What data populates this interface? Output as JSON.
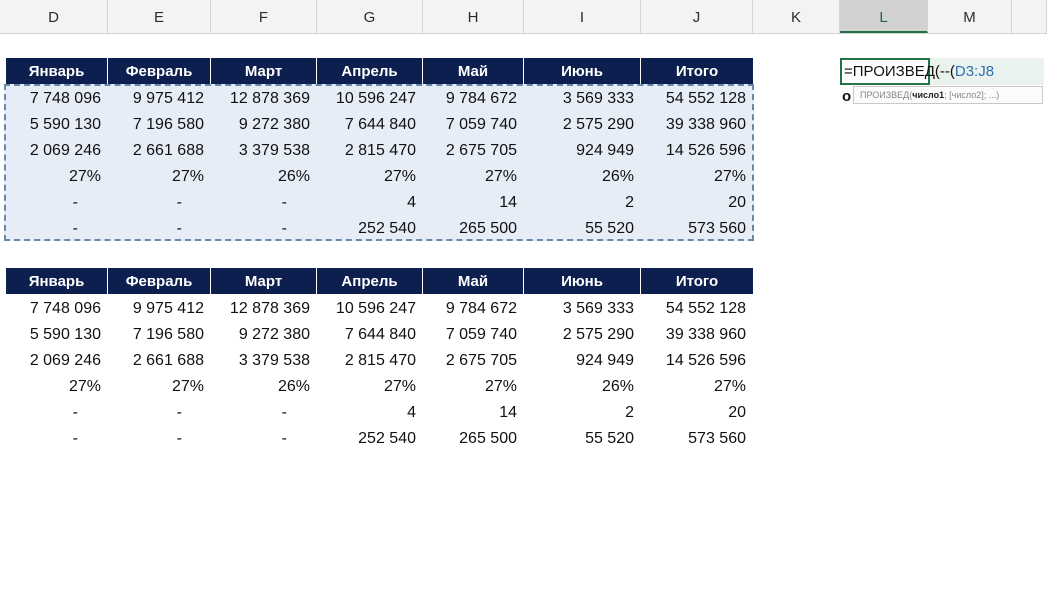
{
  "columns": [
    "D",
    "E",
    "F",
    "G",
    "H",
    "I",
    "J",
    "K",
    "L",
    "M"
  ],
  "active_column": "L",
  "table1": {
    "headers": [
      "Январь",
      "Февраль",
      "Март",
      "Апрель",
      "Май",
      "Июнь",
      "Итого"
    ],
    "rows": [
      [
        "7 748 096",
        "9 975 412",
        "12 878 369",
        "10 596 247",
        "9 784 672",
        "3 569 333",
        "54 552 128"
      ],
      [
        "5 590 130",
        "7 196 580",
        "9 272 380",
        "7 644 840",
        "7 059 740",
        "2 575 290",
        "39 338 960"
      ],
      [
        "2 069 246",
        "2 661 688",
        "3 379 538",
        "2 815 470",
        "2 675 705",
        "924 949",
        "14 526 596"
      ],
      [
        "27%",
        "27%",
        "26%",
        "27%",
        "27%",
        "26%",
        "27%"
      ],
      [
        "-",
        "-",
        "-",
        "4",
        "14",
        "2",
        "20"
      ],
      [
        "-",
        "-",
        "-",
        "252 540",
        "265 500",
        "55 520",
        "573 560"
      ]
    ]
  },
  "table2": {
    "headers": [
      "Январь",
      "Февраль",
      "Март",
      "Апрель",
      "Май",
      "Июнь",
      "Итого"
    ],
    "rows": [
      [
        "7 748 096",
        "9 975 412",
        "12 878 369",
        "10 596 247",
        "9 784 672",
        "3 569 333",
        "54 552 128"
      ],
      [
        "5 590 130",
        "7 196 580",
        "9 272 380",
        "7 644 840",
        "7 059 740",
        "2 575 290",
        "39 338 960"
      ],
      [
        "2 069 246",
        "2 661 688",
        "3 379 538",
        "2 815 470",
        "2 675 705",
        "924 949",
        "14 526 596"
      ],
      [
        "27%",
        "27%",
        "26%",
        "27%",
        "27%",
        "26%",
        "27%"
      ],
      [
        "-",
        "-",
        "-",
        "4",
        "14",
        "2",
        "20"
      ],
      [
        "-",
        "-",
        "-",
        "252 540",
        "265 500",
        "55 520",
        "573 560"
      ]
    ]
  },
  "formula": {
    "prefix": "=ПРОИЗВЕД(--(",
    "ref": "D3:J8"
  },
  "tooltip": {
    "func": "ПРОИЗВЕД(",
    "arg1": "число1",
    "rest": "; [число2]; ...)"
  },
  "row_stub": "о"
}
